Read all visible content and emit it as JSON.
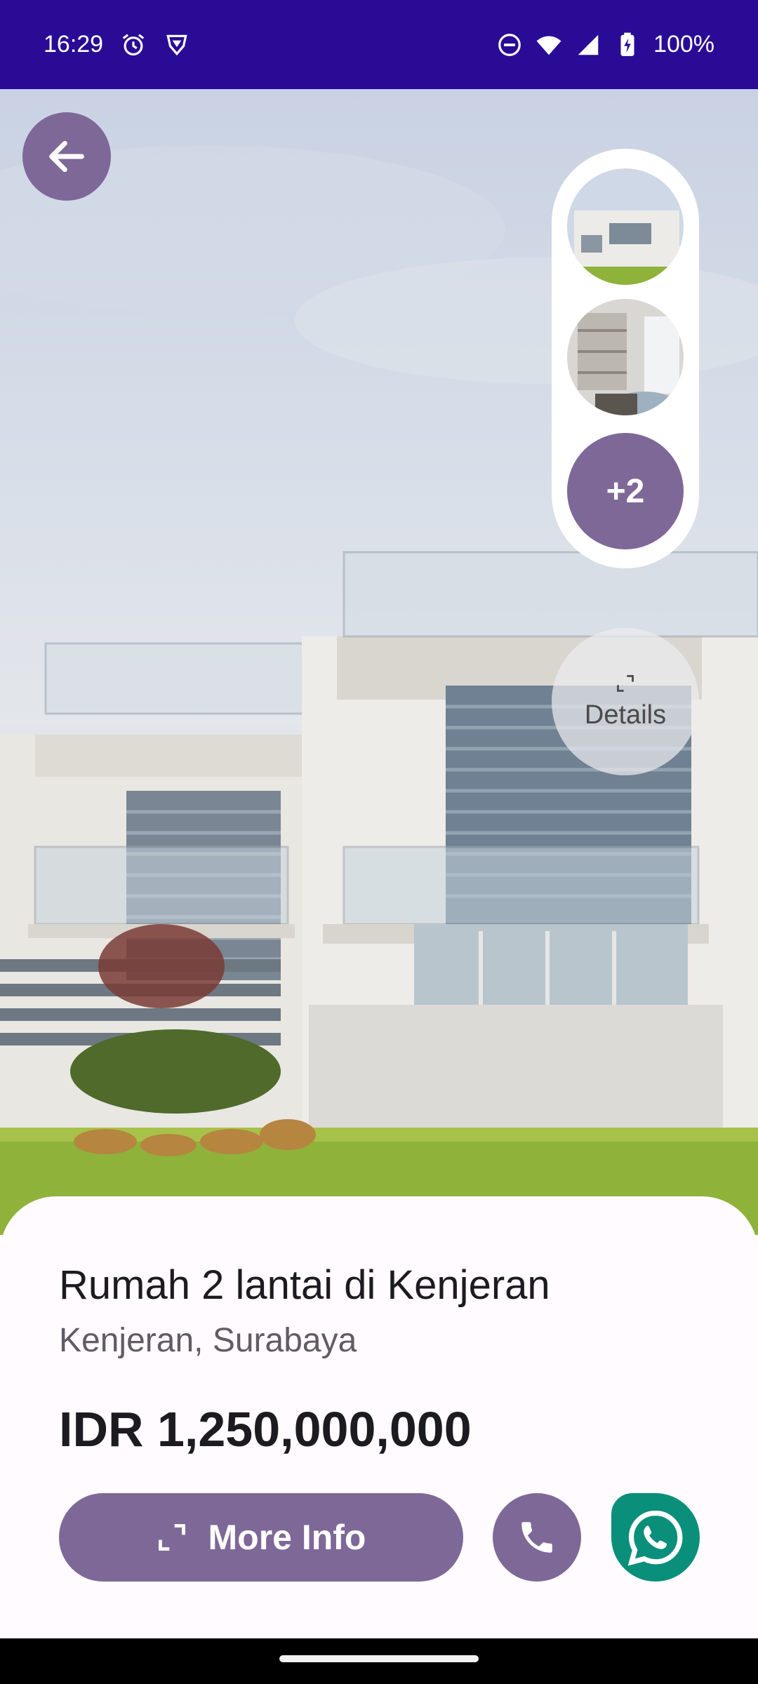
{
  "status_bar": {
    "time": "16:29",
    "battery": "100%",
    "icons": [
      "alarm-icon",
      "vpn-shield-icon",
      "do-not-disturb-icon",
      "wifi-icon",
      "signal-icon",
      "battery-charging-icon"
    ]
  },
  "gallery": {
    "more_count": "+2",
    "details_label": "Details"
  },
  "property": {
    "title": "Rumah 2 lantai di Kenjeran",
    "location": "Kenjeran, Surabaya",
    "price": "IDR 1,250,000,000"
  },
  "actions": {
    "more_info_label": "More Info"
  },
  "colors": {
    "status_bar": "#2a0b96",
    "accent": "#7e6898",
    "whatsapp": "#0a8f7a",
    "card": "#fffbfe"
  }
}
